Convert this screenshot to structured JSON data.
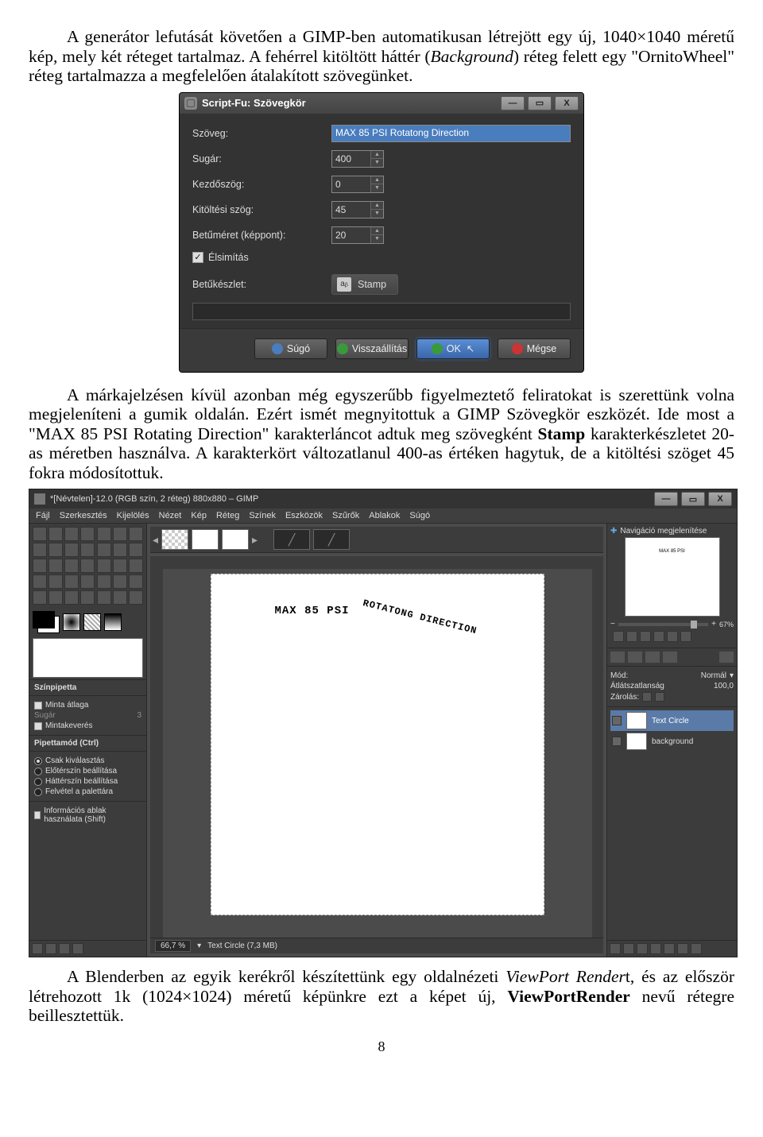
{
  "para1": {
    "a": "A generátor lefutását követően a GIMP-ben automatikusan létrejött egy új, 1040×1040 méretű kép, mely két réteget tartalmaz. A fehérrel kitöltött háttér (",
    "b": "Background",
    "c": ") réteg felett egy \"OrnitoWheel\" réteg tartalmazza a megfelelően átalakított szövegünket."
  },
  "dlg": {
    "title": "Script-Fu: Szövegkör",
    "labels": {
      "text": "Szöveg:",
      "radius": "Sugár:",
      "startAngle": "Kezdőszög:",
      "fillAngle": "Kitöltési szög:",
      "fontSize": "Betűméret (képpont):",
      "antialias": "Élsimítás",
      "font": "Betűkészlet:"
    },
    "values": {
      "text": "MAX 85 PSI   Rotatong Direction",
      "radius": "400",
      "startAngle": "0",
      "fillAngle": "45",
      "fontSize": "20",
      "antialias_checked": "✓",
      "font": "Stamp",
      "fontIcon": "aᵦ"
    },
    "buttons": {
      "help": "Súgó",
      "reset": "Visszaállítás",
      "ok": "OK",
      "cancel": "Mégse"
    },
    "winbtn": {
      "min": "—",
      "max": "▭",
      "close": "X"
    }
  },
  "para2": {
    "a": "A márkajelzésen kívül azonban még egyszerűbb figyelmeztető feliratokat is szerettünk volna megjeleníteni a gumik oldalán. Ezért ismét megnyitottuk a GIMP Szövegkör eszközét. Ide most a \"MAX 85 PSI   Rotating Direction\" karakterláncot adtuk meg szövegként ",
    "b": "Stamp",
    "c": " karakterkészletet 20-as méretben használva. A karakterkört változatlanul 400-as értéken hagytuk, de a kitöltési szöget 45 fokra módosítottuk."
  },
  "gimp": {
    "title": "*[Névtelen]-12.0 (RGB szín, 2 réteg) 880x880 – GIMP",
    "menu": [
      "Fájl",
      "Szerkesztés",
      "Kijelölés",
      "Nézet",
      "Kép",
      "Réteg",
      "Színek",
      "Eszközök",
      "Szűrők",
      "Ablakok",
      "Súgó"
    ],
    "tooloptions": {
      "header": "Színpipetta",
      "avg": "Minta átlaga",
      "radiusLabel": "Sugár",
      "radiusVal": "3",
      "blend": "Mintakeverés",
      "modeHeader": "Pipettamód  (Ctrl)",
      "opt1": "Csak kiválasztás",
      "opt2": "Előtérszín beállítása",
      "opt3": "Háttérszín beállítása",
      "opt4": "Felvétel a palettára",
      "infoShift": "Információs ablak használata  (Shift)"
    },
    "navHeader": "Navigáció megjelenítése",
    "navZoom": "67%",
    "modeLabel": "Mód:",
    "modeValue": "Normál",
    "opacityLabel": "Átlátszatlanság",
    "opacityValue": "100,0",
    "lockLabel": "Zárolás:",
    "layers": {
      "top": "Text Circle",
      "bg": "background"
    },
    "status": {
      "zoom": "66,7 %",
      "doc": "Text Circle (7,3 MB)"
    },
    "curved": {
      "a": "MAX 85 PSI",
      "b": "ROTATONG DIRECTION"
    },
    "winbtn": {
      "min": "—",
      "max": "▭",
      "close": "X"
    }
  },
  "para3": {
    "a": "A Blenderben az egyik kerékről készítettünk egy oldalnézeti ",
    "b": "ViewPort Render",
    "c": "t,  és az először létrehozott 1k (1024×1024) méretű képünkre ezt a képet új, ",
    "d": "ViewPortRender",
    "e": " nevű rétegre beillesztettük."
  },
  "pageNumber": "8"
}
